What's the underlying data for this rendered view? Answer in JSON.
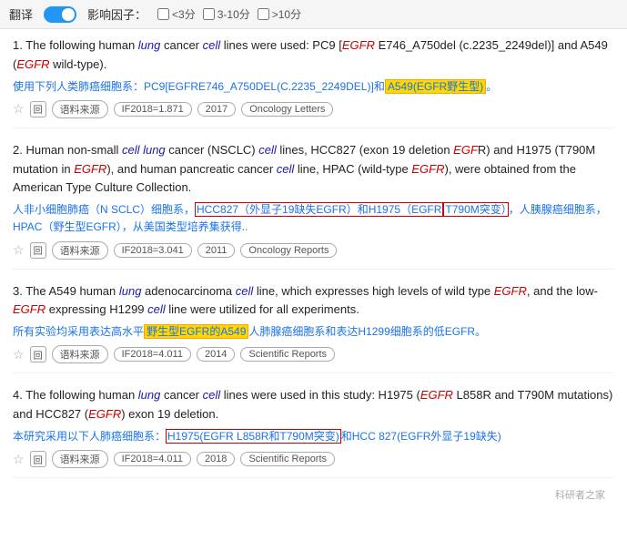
{
  "topbar": {
    "translate_label": "翻译",
    "influence_label": "影响因子：",
    "filter1_label": "<3分",
    "filter2_label": "3-10分",
    "filter3_label": ">10分"
  },
  "results": [
    {
      "number": "1.",
      "en_parts": [
        {
          "text": "The following human ",
          "type": "normal"
        },
        {
          "text": "lung",
          "type": "italic-blue"
        },
        {
          "text": " cancer ",
          "type": "normal"
        },
        {
          "text": "cell",
          "type": "italic-blue"
        },
        {
          "text": " lines were used: PC9 [",
          "type": "normal"
        },
        {
          "text": "EGFR",
          "type": "italic-red"
        },
        {
          "text": " E746_A750del (c.2235_2249del)] and A549 (",
          "type": "normal"
        },
        {
          "text": "EGFR",
          "type": "italic-red"
        },
        {
          "text": " wild-type).",
          "type": "normal"
        }
      ],
      "zh_text": "使用下列人类肺癌细胞系：PC9[EGFRE746_A750DEL(C.2235_2249DEL)]和",
      "zh_highlight": "A549(EGFR野生型)。",
      "source_label": "语料来源",
      "if_label": "IF2018=1.871",
      "year": "2017",
      "journal": "Oncology Letters"
    },
    {
      "number": "2.",
      "en_parts": [
        {
          "text": "Human non-small ",
          "type": "normal"
        },
        {
          "text": "cell lung",
          "type": "italic-blue"
        },
        {
          "text": " cancer (NSCLC) ",
          "type": "normal"
        },
        {
          "text": "cell",
          "type": "italic-blue"
        },
        {
          "text": " lines, HCC827 (exon 19 deletion ",
          "type": "normal"
        },
        {
          "text": "EGF",
          "type": "italic-red"
        },
        {
          "text": "R) and H1975 (T790M mutation in ",
          "type": "normal"
        },
        {
          "text": "EGFR",
          "type": "italic-red"
        },
        {
          "text": "), and human pancreatic cancer ",
          "type": "normal"
        },
        {
          "text": "cell",
          "type": "italic-blue"
        },
        {
          "text": " line, HPAC (wild-type ",
          "type": "normal"
        },
        {
          "text": "EGFR",
          "type": "italic-red"
        },
        {
          "text": "), were obtained from the American Type Culture Collection.",
          "type": "normal"
        }
      ],
      "zh_text": "人非小细胞肺癌（N SCLC）细胞系，",
      "zh_highlight_mid": "HCC827（外显子19缺失EGFR）和H1975（EGFR",
      "zh_highlight_mid2": "T790M突变）",
      "zh_text2": "，人胰腺癌细胞系，HPAC（野生型EGFR），从美国类型培养集获得..",
      "source_label": "语料来源",
      "if_label": "IF2018=3.041",
      "year": "2011",
      "journal": "Oncology Reports"
    },
    {
      "number": "3.",
      "en_parts": [
        {
          "text": "The A549 human ",
          "type": "normal"
        },
        {
          "text": "lung",
          "type": "italic-blue"
        },
        {
          "text": " adenocarcinoma ",
          "type": "normal"
        },
        {
          "text": "cell",
          "type": "italic-blue"
        },
        {
          "text": " line, which expresses high levels of wild type ",
          "type": "normal"
        },
        {
          "text": "EGFR",
          "type": "italic-red"
        },
        {
          "text": ", and the low-",
          "type": "normal"
        },
        {
          "text": "EGFR",
          "type": "italic-red"
        },
        {
          "text": " expressing H1299 ",
          "type": "normal"
        },
        {
          "text": "cell",
          "type": "italic-blue"
        },
        {
          "text": " line were utilized for all experiments.",
          "type": "normal"
        }
      ],
      "zh_text": "所有实验均采用表达高水平",
      "zh_highlight": "野生型EGFR的A549",
      "zh_text2": "人肺腺癌细胞系和表达H1299细胞系的低EGFR。",
      "source_label": "语料来源",
      "if_label": "IF2018=4.011",
      "year": "2014",
      "journal": "Scientific Reports"
    },
    {
      "number": "4.",
      "en_parts": [
        {
          "text": "The following human ",
          "type": "normal"
        },
        {
          "text": "lung",
          "type": "italic-blue"
        },
        {
          "text": " cancer ",
          "type": "normal"
        },
        {
          "text": "cell",
          "type": "italic-blue"
        },
        {
          "text": " lines were used in this study: H1975 (",
          "type": "normal"
        },
        {
          "text": "EGFR",
          "type": "italic-red"
        },
        {
          "text": " L858R and T790M mutations) and HCC827 (",
          "type": "normal"
        },
        {
          "text": "EGFR",
          "type": "italic-red"
        },
        {
          "text": ") exon 19 deletion.",
          "type": "normal"
        }
      ],
      "zh_text": "本研究采用以下人肺癌细胞系：",
      "zh_highlight": "H1975(EGFR L858R和T790M突变)",
      "zh_text2": "和HCC 827(EGFR外显子19缺失)",
      "source_label": "语料来源",
      "if_label": "IF2018=4.011",
      "year": "2018",
      "journal": "Scientific Reports"
    }
  ],
  "watermark": "科研者之家"
}
